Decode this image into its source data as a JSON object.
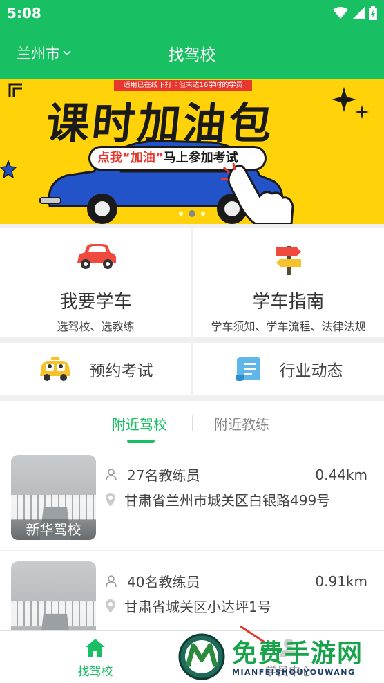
{
  "status_bar": {
    "time": "5:08"
  },
  "header": {
    "city": "兰州市",
    "title": "找驾校"
  },
  "banner": {
    "tag": "适用已在线下打卡但未达16学时的学员",
    "title": "课时加油包",
    "cta_part1": "点我",
    "cta_part2": "“加油”",
    "cta_part3": "马上参加考试"
  },
  "features": {
    "learn": {
      "title": "我要学车",
      "sub": "选驾校、选教练",
      "icon": "car-icon"
    },
    "guide": {
      "title": "学车指南",
      "sub": "学车须知、学车流程、法律法规",
      "icon": "signpost-icon"
    },
    "exam": {
      "title": "预约考试",
      "icon": "taxi-icon"
    },
    "news": {
      "title": "行业动态",
      "icon": "scroll-icon"
    }
  },
  "tabs": {
    "active": "附近驾校",
    "inactive": "附近教练"
  },
  "schools": [
    {
      "name": "新华驾校",
      "coaches": "27名教练员",
      "distance": "0.44km",
      "address": "甘肃省兰州市城关区白银路499号"
    },
    {
      "name": "",
      "coaches": "40名教练员",
      "distance": "0.91km",
      "address": "甘肃省城关区小达坪1号"
    }
  ],
  "bottom_nav": {
    "home": "找驾校",
    "me": "学员中心"
  },
  "watermark": {
    "text": "免费手游网",
    "pinyin": "MIANFEISHOUYOUWANG"
  },
  "colors": {
    "brand_green": "#18c063",
    "banner_yellow": "#ffd20a",
    "accent_red": "#e8382d"
  }
}
